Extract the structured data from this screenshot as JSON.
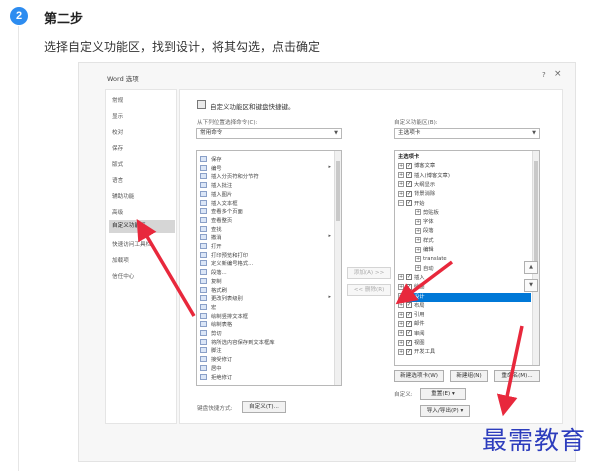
{
  "step": {
    "number": "2",
    "title": "第二步",
    "description": "选择自定义功能区，找到设计，将其勾选，点击确定"
  },
  "dialog": {
    "title": "Word 选项",
    "help": "?",
    "close": "×",
    "nav": [
      {
        "label": "常规"
      },
      {
        "label": "显示"
      },
      {
        "label": "校对"
      },
      {
        "label": "保存"
      },
      {
        "label": "版式"
      },
      {
        "label": "语言"
      },
      {
        "label": "辅助功能"
      },
      {
        "label": "高级"
      },
      {
        "label": "自定义功能区"
      },
      {
        "label": "快速访问工具栏"
      },
      {
        "label": "加载项"
      },
      {
        "label": "信任中心"
      }
    ],
    "active_nav": "自定义功能区",
    "header": "自定义功能区和键盘快捷键。",
    "left_label": "从下列位置选择命令(C):",
    "left_combo": "常用命令",
    "commands": [
      "保存",
      "编号",
      "插入分页符和分节符",
      "插入批注",
      "插入图片",
      "插入文本框",
      "查看多个页面",
      "查看整页",
      "查找",
      "撤消",
      "打开",
      "打印预览和打印",
      "定义新编号格式...",
      "段落...",
      "复制",
      "格式刷",
      "更改列表级别",
      "宏",
      "绘制竖排文本框",
      "绘制表格",
      "剪切",
      "将所选内容保存到文本框库",
      "脚注",
      "接受修订",
      "居中",
      "拒绝修订"
    ],
    "right_label": "自定义功能区(B):",
    "right_combo": "主选项卡",
    "tree": [
      {
        "label": "主选项卡",
        "level": 0,
        "header": true
      },
      {
        "label": "博客文章",
        "level": 1,
        "exp": "+",
        "checked": true
      },
      {
        "label": "插入(博客文章)",
        "level": 1,
        "exp": "+",
        "checked": true
      },
      {
        "label": "大纲显示",
        "level": 1,
        "exp": "+",
        "checked": true
      },
      {
        "label": "背景消除",
        "level": 1,
        "exp": "+",
        "checked": true
      },
      {
        "label": "开始",
        "level": 1,
        "exp": "−",
        "checked": true
      },
      {
        "label": "剪贴板",
        "level": 2,
        "exp": "+"
      },
      {
        "label": "字体",
        "level": 2,
        "exp": "+"
      },
      {
        "label": "段落",
        "level": 2,
        "exp": "+"
      },
      {
        "label": "样式",
        "level": 2,
        "exp": "+"
      },
      {
        "label": "编辑",
        "level": 2,
        "exp": "+"
      },
      {
        "label": "translate",
        "level": 2,
        "exp": "+"
      },
      {
        "label": "自动",
        "level": 2,
        "exp": "+"
      },
      {
        "label": "插入",
        "level": 1,
        "exp": "+",
        "checked": true
      },
      {
        "label": "绘图",
        "level": 1,
        "exp": "+",
        "checked": true
      },
      {
        "label": "设计",
        "level": 1,
        "exp": "+",
        "checked": true,
        "selected": true
      },
      {
        "label": "布局",
        "level": 1,
        "exp": "+",
        "checked": true
      },
      {
        "label": "引用",
        "level": 1,
        "exp": "+",
        "checked": true
      },
      {
        "label": "邮件",
        "level": 1,
        "exp": "+",
        "checked": true
      },
      {
        "label": "审阅",
        "level": 1,
        "exp": "+",
        "checked": true
      },
      {
        "label": "视图",
        "level": 1,
        "exp": "+",
        "checked": true
      },
      {
        "label": "开发工具",
        "level": 1,
        "exp": "+",
        "checked": true
      }
    ],
    "add_button": "添加(A) >>",
    "remove_button": "<< 删除(R)",
    "move_up": "▲",
    "move_down": "▼",
    "new_tab_button": "新建选项卡(W)",
    "new_group_button": "新建组(N)",
    "rename_button": "重命名(M)...",
    "customize_label": "自定义:",
    "reset_button": "重置(E) ▾",
    "import_export_button": "导入/导出(P) ▾",
    "shortcut_label": "键盘快捷方式:",
    "shortcut_button": "自定义(T)..."
  },
  "annotation_color": "#e8283c",
  "watermark": "最需教育"
}
